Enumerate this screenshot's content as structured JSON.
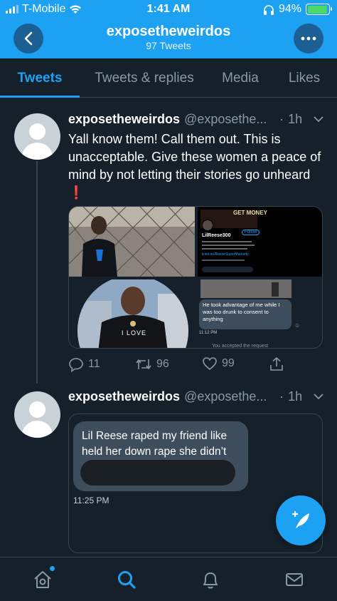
{
  "status_bar": {
    "carrier": "T-Mobile",
    "time": "1:41 AM",
    "battery": "94%",
    "battery_level": 0.94
  },
  "header": {
    "title": "exposetheweirdos",
    "subtitle": "97 Tweets",
    "back_icon": "chevron-left-icon",
    "more_icon": "more-horizontal-icon"
  },
  "tabs": [
    {
      "label": "Tweets",
      "active": true
    },
    {
      "label": "Tweets & replies",
      "active": false
    },
    {
      "label": "Media",
      "active": false
    },
    {
      "label": "Likes",
      "active": false
    }
  ],
  "tweets": [
    {
      "name": "exposetheweirdos",
      "handle": "@exposethe...",
      "time": "1h",
      "text": "Yall know them! Call them out. This is unacceptable. Give these women a peace of mind by not letting their stories go unheard",
      "emoji": "❗",
      "media": {
        "profile_name": "LilReese300",
        "profile_tag": "GET MONEY",
        "follow_label": "Follow",
        "bio_link": "linktr.ee/ReeseSuperMarketty",
        "dm_text": "He took advantage of me while I was too drunk to consent to anything",
        "dm_time": "11:12 PM",
        "dm_footer": "You accepted the request",
        "jacket_text": "I LOVE"
      },
      "replies": "11",
      "retweets": "96",
      "likes": "99"
    },
    {
      "name": "exposetheweirdos",
      "handle": "@exposethe...",
      "time": "1h",
      "message": "Lil Reese raped my friend like held her down rape she didn’t",
      "message_time": "11:25 PM"
    }
  ],
  "colors": {
    "background": "#15202b",
    "accent": "#1da1f2",
    "muted": "#8899a6",
    "border": "#38444d"
  }
}
